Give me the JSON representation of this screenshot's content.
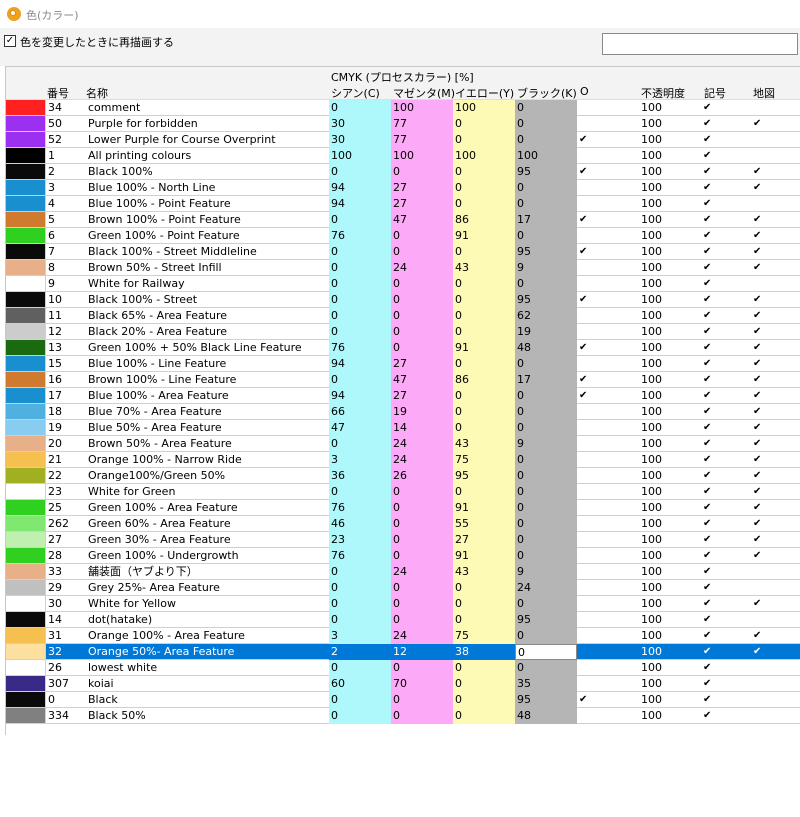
{
  "window": {
    "title": "色(カラー)"
  },
  "toolbar": {
    "redraw_checkbox_checked": true,
    "redraw_label": "色を変更したときに再描画する",
    "search_value": "",
    "check_glyph": "✓"
  },
  "grid": {
    "group_header": "CMYK (プロセスカラー) [%]",
    "columns": {
      "num": "番号",
      "name": "名称",
      "cyan": "シアン(C)",
      "magenta": "マゼンタ(M)",
      "yellow": "イエロー(Y)",
      "black": "ブラック(K)",
      "overprint": "O",
      "opacity": "不透明度",
      "symbol": "記号",
      "map": "地図"
    },
    "selected_index": 34,
    "rows": [
      {
        "swatch": "#ff2020",
        "num": "34",
        "name": "comment",
        "c": "0",
        "m": "100",
        "y": "100",
        "k": "0",
        "o": "",
        "op": "100",
        "sym": "✔",
        "map": ""
      },
      {
        "swatch": "#9b30f0",
        "num": "50",
        "name": "Purple for forbidden",
        "c": "30",
        "m": "77",
        "y": "0",
        "k": "0",
        "o": "",
        "op": "100",
        "sym": "✔",
        "map": "✔"
      },
      {
        "swatch": "#9b30f0",
        "num": "52",
        "name": "Lower Purple for Course Overprint",
        "c": "30",
        "m": "77",
        "y": "0",
        "k": "0",
        "o": "✔",
        "op": "100",
        "sym": "✔",
        "map": ""
      },
      {
        "swatch": "#000000",
        "num": "1",
        "name": "All printing colours",
        "c": "100",
        "m": "100",
        "y": "100",
        "k": "100",
        "o": "",
        "op": "100",
        "sym": "✔",
        "map": ""
      },
      {
        "swatch": "#0a0a0a",
        "num": "2",
        "name": "Black 100%",
        "c": "0",
        "m": "0",
        "y": "0",
        "k": "95",
        "o": "✔",
        "op": "100",
        "sym": "✔",
        "map": "✔"
      },
      {
        "swatch": "#1a8fd0",
        "num": "3",
        "name": "Blue 100% - North Line",
        "c": "94",
        "m": "27",
        "y": "0",
        "k": "0",
        "o": "",
        "op": "100",
        "sym": "✔",
        "map": "✔"
      },
      {
        "swatch": "#1a8fd0",
        "num": "4",
        "name": "Blue 100% - Point Feature",
        "c": "94",
        "m": "27",
        "y": "0",
        "k": "0",
        "o": "",
        "op": "100",
        "sym": "✔",
        "map": ""
      },
      {
        "swatch": "#d07a30",
        "num": "5",
        "name": "Brown 100%  - Point Feature",
        "c": "0",
        "m": "47",
        "y": "86",
        "k": "17",
        "o": "✔",
        "op": "100",
        "sym": "✔",
        "map": "✔"
      },
      {
        "swatch": "#30d020",
        "num": "6",
        "name": "Green 100%  - Point Feature",
        "c": "76",
        "m": "0",
        "y": "91",
        "k": "0",
        "o": "",
        "op": "100",
        "sym": "✔",
        "map": "✔"
      },
      {
        "swatch": "#0a0a0a",
        "num": "7",
        "name": "Black 100% - Street Middleline",
        "c": "0",
        "m": "0",
        "y": "0",
        "k": "95",
        "o": "✔",
        "op": "100",
        "sym": "✔",
        "map": "✔"
      },
      {
        "swatch": "#e8b088",
        "num": "8",
        "name": "Brown 50% - Street Infill",
        "c": "0",
        "m": "24",
        "y": "43",
        "k": "9",
        "o": "",
        "op": "100",
        "sym": "✔",
        "map": "✔"
      },
      {
        "swatch": "#ffffff",
        "num": "9",
        "name": "White for Railway",
        "c": "0",
        "m": "0",
        "y": "0",
        "k": "0",
        "o": "",
        "op": "100",
        "sym": "✔",
        "map": ""
      },
      {
        "swatch": "#0a0a0a",
        "num": "10",
        "name": "Black 100% - Street",
        "c": "0",
        "m": "0",
        "y": "0",
        "k": "95",
        "o": "✔",
        "op": "100",
        "sym": "✔",
        "map": "✔"
      },
      {
        "swatch": "#606060",
        "num": "11",
        "name": "Black 65% - Area Feature",
        "c": "0",
        "m": "0",
        "y": "0",
        "k": "62",
        "o": "",
        "op": "100",
        "sym": "✔",
        "map": "✔"
      },
      {
        "swatch": "#cccccc",
        "num": "12",
        "name": "Black 20% - Area Feature",
        "c": "0",
        "m": "0",
        "y": "0",
        "k": "19",
        "o": "",
        "op": "100",
        "sym": "✔",
        "map": "✔"
      },
      {
        "swatch": "#1a6a10",
        "num": "13",
        "name": "Green 100% + 50% Black Line Feature",
        "c": "76",
        "m": "0",
        "y": "91",
        "k": "48",
        "o": "✔",
        "op": "100",
        "sym": "✔",
        "map": "✔"
      },
      {
        "swatch": "#1a8fd0",
        "num": "15",
        "name": "Blue 100%  - Line Feature",
        "c": "94",
        "m": "27",
        "y": "0",
        "k": "0",
        "o": "",
        "op": "100",
        "sym": "✔",
        "map": "✔"
      },
      {
        "swatch": "#d07a30",
        "num": "16",
        "name": "Brown 100% - Line Feature",
        "c": "0",
        "m": "47",
        "y": "86",
        "k": "17",
        "o": "✔",
        "op": "100",
        "sym": "✔",
        "map": "✔"
      },
      {
        "swatch": "#1a8fd0",
        "num": "17",
        "name": "Blue 100% - Area Feature",
        "c": "94",
        "m": "27",
        "y": "0",
        "k": "0",
        "o": "✔",
        "op": "100",
        "sym": "✔",
        "map": "✔"
      },
      {
        "swatch": "#50b0e0",
        "num": "18",
        "name": "Blue 70% - Area Feature",
        "c": "66",
        "m": "19",
        "y": "0",
        "k": "0",
        "o": "",
        "op": "100",
        "sym": "✔",
        "map": "✔"
      },
      {
        "swatch": "#88cdf0",
        "num": "19",
        "name": "Blue 50% - Area Feature",
        "c": "47",
        "m": "14",
        "y": "0",
        "k": "0",
        "o": "",
        "op": "100",
        "sym": "✔",
        "map": "✔"
      },
      {
        "swatch": "#e8b088",
        "num": "20",
        "name": "Brown 50% - Area Feature",
        "c": "0",
        "m": "24",
        "y": "43",
        "k": "9",
        "o": "",
        "op": "100",
        "sym": "✔",
        "map": "✔"
      },
      {
        "swatch": "#f6c050",
        "num": "21",
        "name": "Orange 100% - Narrow Ride",
        "c": "3",
        "m": "24",
        "y": "75",
        "k": "0",
        "o": "",
        "op": "100",
        "sym": "✔",
        "map": "✔"
      },
      {
        "swatch": "#a0b020",
        "num": "22",
        "name": "Orange100%/Green 50%",
        "c": "36",
        "m": "26",
        "y": "95",
        "k": "0",
        "o": "",
        "op": "100",
        "sym": "✔",
        "map": "✔"
      },
      {
        "swatch": "#ffffff",
        "num": "23",
        "name": "White for Green",
        "c": "0",
        "m": "0",
        "y": "0",
        "k": "0",
        "o": "",
        "op": "100",
        "sym": "✔",
        "map": "✔"
      },
      {
        "swatch": "#30d020",
        "num": "25",
        "name": "Green 100% - Area Feature",
        "c": "76",
        "m": "0",
        "y": "91",
        "k": "0",
        "o": "",
        "op": "100",
        "sym": "✔",
        "map": "✔"
      },
      {
        "swatch": "#80e870",
        "num": "262",
        "name": "Green 60% - Area Feature",
        "c": "46",
        "m": "0",
        "y": "55",
        "k": "0",
        "o": "",
        "op": "100",
        "sym": "✔",
        "map": "✔"
      },
      {
        "swatch": "#c0f0b0",
        "num": "27",
        "name": "Green 30% - Area Feature",
        "c": "23",
        "m": "0",
        "y": "27",
        "k": "0",
        "o": "",
        "op": "100",
        "sym": "✔",
        "map": "✔"
      },
      {
        "swatch": "#30d020",
        "num": "28",
        "name": "Green 100% - Undergrowth",
        "c": "76",
        "m": "0",
        "y": "91",
        "k": "0",
        "o": "",
        "op": "100",
        "sym": "✔",
        "map": "✔"
      },
      {
        "swatch": "#e8b088",
        "num": "33",
        "name": "舗装面（ヤブより下）",
        "c": "0",
        "m": "24",
        "y": "43",
        "k": "9",
        "o": "",
        "op": "100",
        "sym": "✔",
        "map": ""
      },
      {
        "swatch": "#c0c0c0",
        "num": "29",
        "name": "Grey 25%- Area Feature",
        "c": "0",
        "m": "0",
        "y": "0",
        "k": "24",
        "o": "",
        "op": "100",
        "sym": "✔",
        "map": ""
      },
      {
        "swatch": "#ffffff",
        "num": "30",
        "name": "White for Yellow",
        "c": "0",
        "m": "0",
        "y": "0",
        "k": "0",
        "o": "",
        "op": "100",
        "sym": "✔",
        "map": "✔"
      },
      {
        "swatch": "#0a0a0a",
        "num": "14",
        "name": "dot(hatake)",
        "c": "0",
        "m": "0",
        "y": "0",
        "k": "95",
        "o": "",
        "op": "100",
        "sym": "✔",
        "map": ""
      },
      {
        "swatch": "#f6c050",
        "num": "31",
        "name": "Orange 100% - Area Feature",
        "c": "3",
        "m": "24",
        "y": "75",
        "k": "0",
        "o": "",
        "op": "100",
        "sym": "✔",
        "map": "✔"
      },
      {
        "swatch": "#fde0a0",
        "num": "32",
        "name": "Orange 50%- Area Feature",
        "c": "2",
        "m": "12",
        "y": "38",
        "k": "0",
        "o": "",
        "op": "100",
        "sym": "✔",
        "map": "✔"
      },
      {
        "swatch": "#ffffff",
        "num": "26",
        "name": "lowest white",
        "c": "0",
        "m": "0",
        "y": "0",
        "k": "0",
        "o": "",
        "op": "100",
        "sym": "✔",
        "map": ""
      },
      {
        "swatch": "#3a2a88",
        "num": "307",
        "name": "koiai",
        "c": "60",
        "m": "70",
        "y": "0",
        "k": "35",
        "o": "",
        "op": "100",
        "sym": "✔",
        "map": ""
      },
      {
        "swatch": "#0a0a0a",
        "num": "0",
        "name": "Black",
        "c": "0",
        "m": "0",
        "y": "0",
        "k": "95",
        "o": "✔",
        "op": "100",
        "sym": "✔",
        "map": ""
      },
      {
        "swatch": "#808080",
        "num": "334",
        "name": "Black 50%",
        "c": "0",
        "m": "0",
        "y": "0",
        "k": "48",
        "o": "",
        "op": "100",
        "sym": "✔",
        "map": ""
      }
    ]
  }
}
